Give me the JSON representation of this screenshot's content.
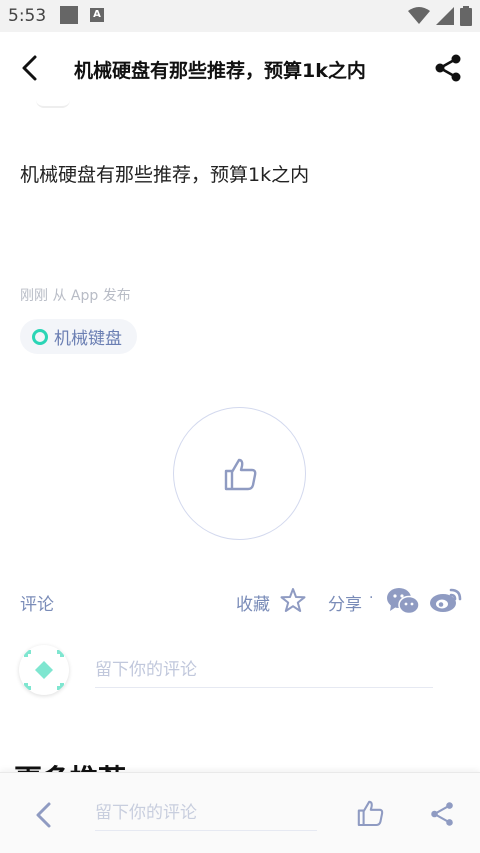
{
  "status_bar": {
    "time": "5:53",
    "a_badge": "A"
  },
  "header": {
    "title": "机械硬盘有那些推荐，预算1k之内"
  },
  "post": {
    "body": "机械硬盘有那些推荐，预算1k之内",
    "meta": "刚刚 从 App 发布",
    "tag": "机械键盘"
  },
  "actions": {
    "comment_label": "评论",
    "favorite_label": "收藏",
    "share_label": "分享",
    "separator": "·"
  },
  "comment": {
    "placeholder": "留下你的评论"
  },
  "section_peek": "更多推荐",
  "bottom_bar": {
    "placeholder": "留下你的评论"
  },
  "colors": {
    "accent": "#6b7fb3",
    "tag_ring": "#2bd5b6",
    "icon_gray": "#8f9bc2"
  }
}
